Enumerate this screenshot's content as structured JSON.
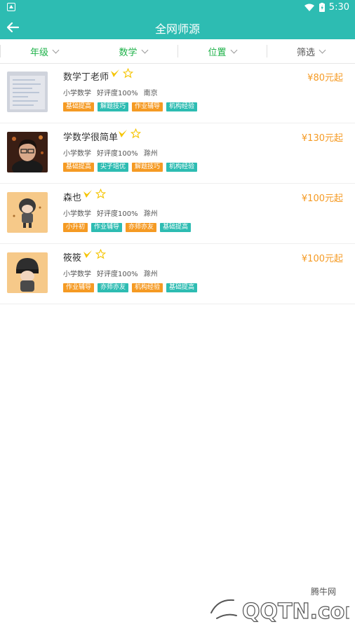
{
  "status_bar": {
    "time": "5:30"
  },
  "app_bar": {
    "title": "全网师源"
  },
  "filters": [
    {
      "label": "年级",
      "color": "#1fb24a"
    },
    {
      "label": "数学",
      "color": "#1fb24a"
    },
    {
      "label": "位置",
      "color": "#1fb24a"
    },
    {
      "label": "筛选",
      "color": "#555555"
    }
  ],
  "teachers": [
    {
      "name": "数学丁老师",
      "price": "¥80元起",
      "subject": "小学数学",
      "rating": "好评度100%",
      "city": "南京",
      "tags": [
        {
          "text": "基础提高",
          "color": "orange"
        },
        {
          "text": "解题技巧",
          "color": "teal"
        },
        {
          "text": "作业辅导",
          "color": "orange"
        },
        {
          "text": "机构经验",
          "color": "teal"
        }
      ]
    },
    {
      "name": "学数学很简单",
      "price": "¥130元起",
      "subject": "小学数学",
      "rating": "好评度100%",
      "city": "滁州",
      "tags": [
        {
          "text": "基础提高",
          "color": "orange"
        },
        {
          "text": "尖子培优",
          "color": "teal"
        },
        {
          "text": "解题技巧",
          "color": "orange"
        },
        {
          "text": "机构经验",
          "color": "teal"
        }
      ]
    },
    {
      "name": "森也",
      "price": "¥100元起",
      "subject": "小学数学",
      "rating": "好评度100%",
      "city": "滁州",
      "tags": [
        {
          "text": "小升初",
          "color": "orange"
        },
        {
          "text": "作业辅导",
          "color": "teal"
        },
        {
          "text": "亦师亦友",
          "color": "orange"
        },
        {
          "text": "基础提高",
          "color": "teal"
        }
      ]
    },
    {
      "name": "筱筱",
      "price": "¥100元起",
      "subject": "小学数学",
      "rating": "好评度100%",
      "city": "滁州",
      "tags": [
        {
          "text": "作业辅导",
          "color": "orange"
        },
        {
          "text": "亦师亦友",
          "color": "teal"
        },
        {
          "text": "机构经验",
          "color": "orange"
        },
        {
          "text": "基础提高",
          "color": "teal"
        }
      ]
    }
  ],
  "watermark": {
    "text_top": "腾牛网",
    "text_main": "QQTN.com"
  }
}
